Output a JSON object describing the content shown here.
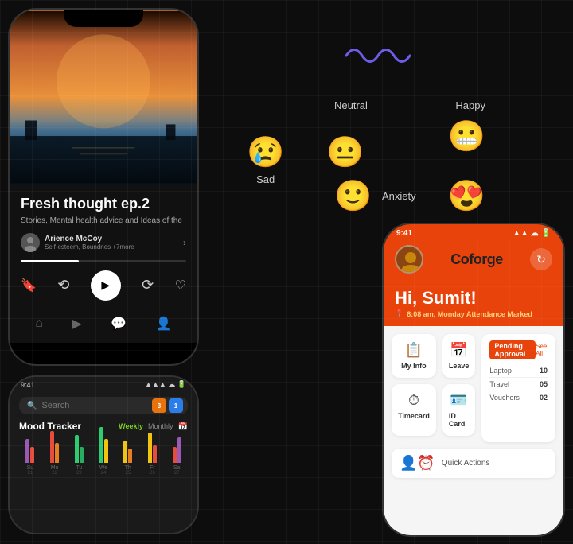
{
  "background": "#0d0d0d",
  "podcast_phone": {
    "title": "Fresh thought ep.2",
    "subtitle": "Stories, Mental health advice and Ideas of the",
    "author_name": "Arience McCoy",
    "author_tags": "Self-esteem, Boundries +7more",
    "progress_percent": 35
  },
  "mood_phone": {
    "status_time": "9:41",
    "search_placeholder": "Search",
    "badge1": "3",
    "badge2": "1",
    "title": "Mood Tracker",
    "tab_weekly": "Weekly",
    "tab_monthly": "Monthly",
    "days": [
      {
        "label": "Su",
        "date": "21"
      },
      {
        "label": "Mo",
        "date": "22"
      },
      {
        "label": "Tu",
        "date": "23"
      },
      {
        "label": "We",
        "date": "24"
      },
      {
        "label": "Th",
        "date": "25"
      },
      {
        "label": "Fr",
        "date": "26"
      },
      {
        "label": "Sa",
        "date": "27"
      }
    ]
  },
  "emotions": {
    "wave_label": "wave-icon",
    "items": [
      {
        "emoji": "😢",
        "label": "Sad",
        "position": "left"
      },
      {
        "emoji": "😐",
        "label": "Neutral",
        "position": "center-top"
      },
      {
        "emoji": "😬",
        "label": "Happy",
        "position": "right"
      },
      {
        "emoji": "🙂",
        "label": "",
        "position": "center-bottom"
      },
      {
        "emoji": "😍",
        "label": "Anxiety",
        "position": "right-bottom"
      }
    ],
    "neutral_label": "Neutral",
    "happy_label": "Happy",
    "sad_label": "Sad",
    "anxiety_label": "Anxiety"
  },
  "coforge_phone": {
    "status_time": "9:41",
    "logo_text": "Coforge",
    "greeting": "Hi, Sumit!",
    "attendance_text": "8:08 am, Monday  Attendance Marked",
    "cards": [
      {
        "icon": "📋",
        "label": "My Info"
      },
      {
        "icon": "📅",
        "label": "Leave"
      },
      {
        "icon": "⏱",
        "label": "Timecard"
      },
      {
        "icon": "🪪",
        "label": "ID Card"
      }
    ],
    "pending_title": "Pending Approval",
    "see_all": "See All",
    "pending_items": [
      {
        "item": "Laptop",
        "count": "10"
      },
      {
        "item": "Travel",
        "count": "05"
      },
      {
        "item": "Vouchers",
        "count": "02"
      }
    ]
  }
}
